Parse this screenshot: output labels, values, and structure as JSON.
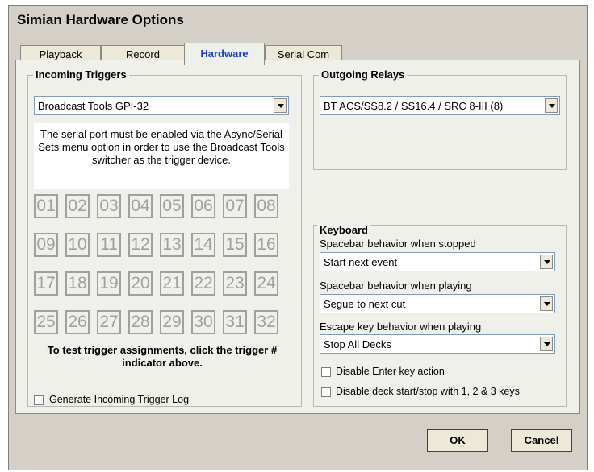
{
  "window": {
    "title": "Simian Hardware Options"
  },
  "tabs": [
    {
      "label": "Playback"
    },
    {
      "label": "Record"
    },
    {
      "label": "Hardware"
    },
    {
      "label": "Serial Com"
    }
  ],
  "incoming": {
    "group_label": "Incoming Triggers",
    "device": "Broadcast Tools GPI-32",
    "info": "The serial port must be enabled via the Async/Serial Sets menu option in order to use the Broadcast Tools switcher as the trigger device.",
    "triggers": [
      "01",
      "02",
      "03",
      "04",
      "05",
      "06",
      "07",
      "08",
      "09",
      "10",
      "11",
      "12",
      "13",
      "14",
      "15",
      "16",
      "17",
      "18",
      "19",
      "20",
      "21",
      "22",
      "23",
      "24",
      "25",
      "26",
      "27",
      "28",
      "29",
      "30",
      "31",
      "32"
    ],
    "hint": "To test trigger assignments, click the trigger # indicator above.",
    "log_label": "Generate Incoming Trigger Log"
  },
  "outgoing": {
    "group_label": "Outgoing Relays",
    "device": "BT ACS/SS8.2 / SS16.4 / SRC 8-III (8)"
  },
  "keyboard": {
    "group_label": "Keyboard",
    "stopped_label": "Spacebar behavior when stopped",
    "stopped_value": "Start next event",
    "playing_label": "Spacebar behavior when playing",
    "playing_value": "Segue to next cut",
    "escape_label": "Escape key behavior when playing",
    "escape_value": "Stop All Decks",
    "disable_enter": "Disable Enter key action",
    "disable_deck": "Disable deck start/stop with 1, 2 & 3 keys"
  },
  "buttons": {
    "ok_ul": "O",
    "ok_rest": "K",
    "cancel_ul": "C",
    "cancel_rest": "ancel"
  }
}
